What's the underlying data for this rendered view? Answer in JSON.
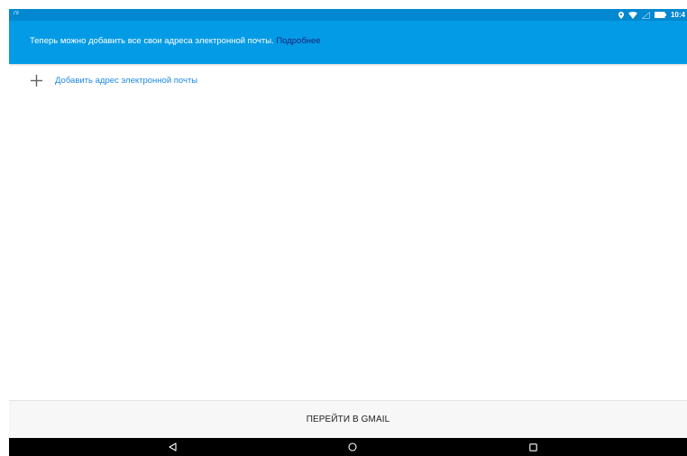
{
  "status_bar": {
    "left_text": "79",
    "clock": "10:4",
    "icons": [
      "location-icon",
      "wifi-icon",
      "signal-icon",
      "battery-icon"
    ]
  },
  "banner": {
    "message": "Теперь можно добавить все свои адреса электронной почты.",
    "link_label": "Подробнее"
  },
  "add_email": {
    "icon": "plus-icon",
    "label": "Добавить адрес электронной почты"
  },
  "bottom": {
    "gmail_button_label": "ПЕРЕЙТИ В GMAIL"
  },
  "nav_bar": {
    "buttons": [
      "back-icon",
      "home-icon",
      "recents-icon"
    ]
  },
  "colors": {
    "status_bar": "#0288d1",
    "banner": "#039be5",
    "banner_link": "#1a237e",
    "accent": "#1e88e5"
  }
}
